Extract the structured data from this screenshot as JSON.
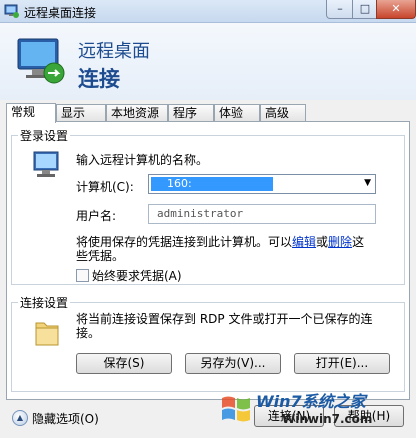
{
  "window": {
    "title": "远程桌面连接",
    "minimize": "–",
    "maximize": "□",
    "close": "✕"
  },
  "banner": {
    "line1": "远程桌面",
    "line2": "连接"
  },
  "tabs": [
    "常规",
    "显示",
    "本地资源",
    "程序",
    "体验",
    "高级"
  ],
  "login": {
    "legend": "登录设置",
    "hint": "输入远程计算机的名称。",
    "computer_label": "计算机(C):",
    "computer_value": "160:",
    "username_label": "用户名:",
    "username_value": "administrator",
    "note_pre": "将使用保存的凭据连接到此计算机。可以",
    "note_edit": "编辑",
    "note_or": "或",
    "note_delete": "删除",
    "note_post": "这些凭据。",
    "always_ask": "始终要求凭据(A)"
  },
  "connection": {
    "legend": "连接设置",
    "hint": "将当前连接设置保存到 RDP 文件或打开一个已保存的连接。",
    "save": "保存(S)",
    "save_as": "另存为(V)...",
    "open": "打开(E)..."
  },
  "footer": {
    "hide_options": "隐藏选项(O)",
    "connect": "连接(N)",
    "help": "帮助(H)"
  },
  "watermark": {
    "text": "Win7系统之家",
    "url": "Winwin7.com"
  },
  "colors": {
    "title_blue": "#1d4b8f",
    "selection": "#3399ff",
    "link": "#0033cc"
  }
}
